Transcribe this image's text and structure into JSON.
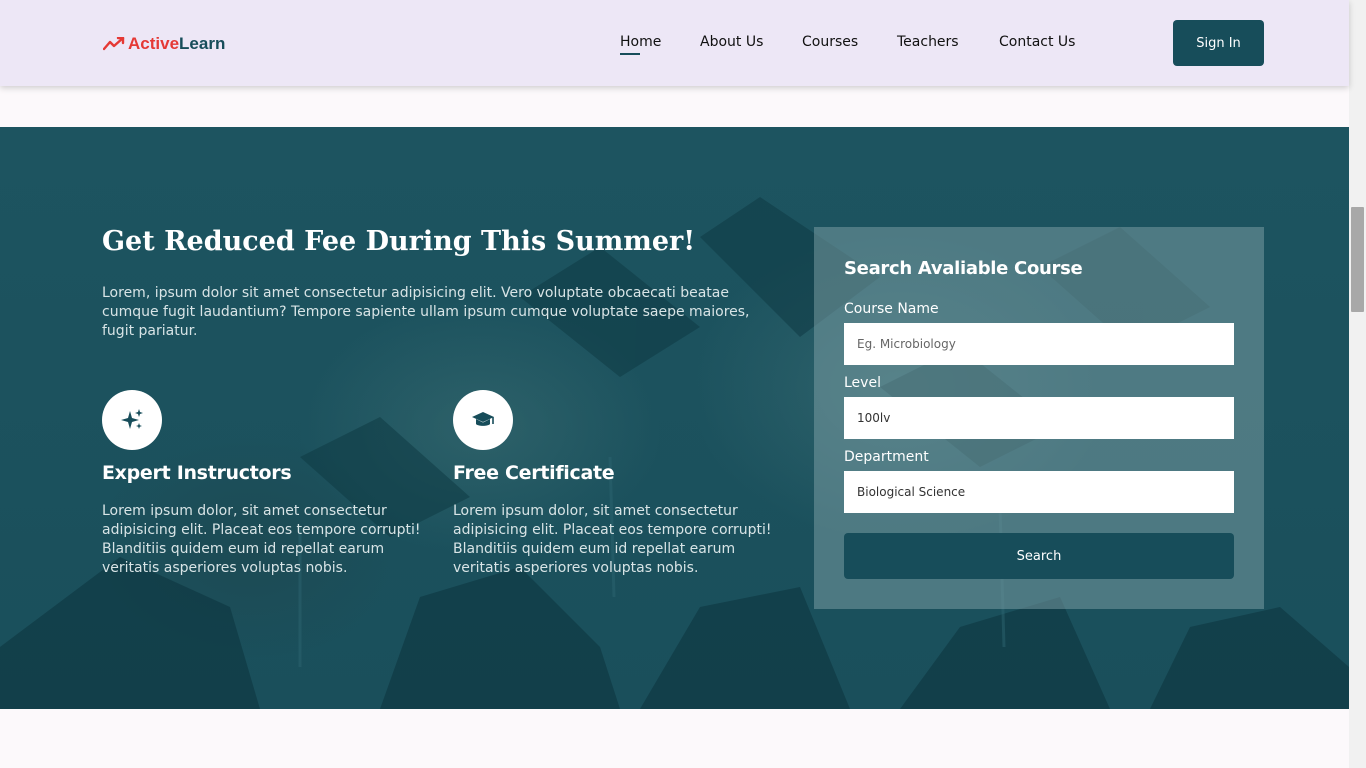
{
  "header": {
    "logo": {
      "part1": "Active",
      "part2": "Learn"
    },
    "nav": [
      {
        "label": "Home",
        "active": true
      },
      {
        "label": "About Us"
      },
      {
        "label": "Courses"
      },
      {
        "label": "Teachers"
      },
      {
        "label": "Contact Us"
      }
    ],
    "signin_label": "Sign In"
  },
  "hero": {
    "title": "Get Reduced Fee During This Summer!",
    "text": "Lorem, ipsum dolor sit amet consectetur adipisicing elit. Vero voluptate obcaecati beatae cumque fugit laudantium? Tempore sapiente ullam ipsum cumque voluptate saepe maiores, fugit pariatur.",
    "features": [
      {
        "icon": "sparkles-icon",
        "title": "Expert Instructors",
        "text": "Lorem ipsum dolor, sit amet consectetur adipisicing elit. Placeat eos tempore corrupti! Blanditiis quidem eum id repellat earum veritatis asperiores voluptas nobis."
      },
      {
        "icon": "graduation-cap-icon",
        "title": "Free Certificate",
        "text": "Lorem ipsum dolor, sit amet consectetur adipisicing elit. Placeat eos tempore corrupti! Blanditiis quidem eum id repellat earum veritatis asperiores voluptas nobis."
      }
    ]
  },
  "search_panel": {
    "title": "Search Avaliable Course",
    "fields": [
      {
        "label": "Course Name",
        "placeholder": "Eg. Microbiology",
        "value": ""
      },
      {
        "label": "Level",
        "placeholder": "",
        "value": "100lv"
      },
      {
        "label": "Department",
        "placeholder": "",
        "value": "Biological Science"
      }
    ],
    "button_label": "Search"
  },
  "colors": {
    "brand_dark": "#174d5a",
    "logo_red": "#e53935",
    "header_bg": "#ede7f6",
    "hero_bg": "#1b505c"
  }
}
